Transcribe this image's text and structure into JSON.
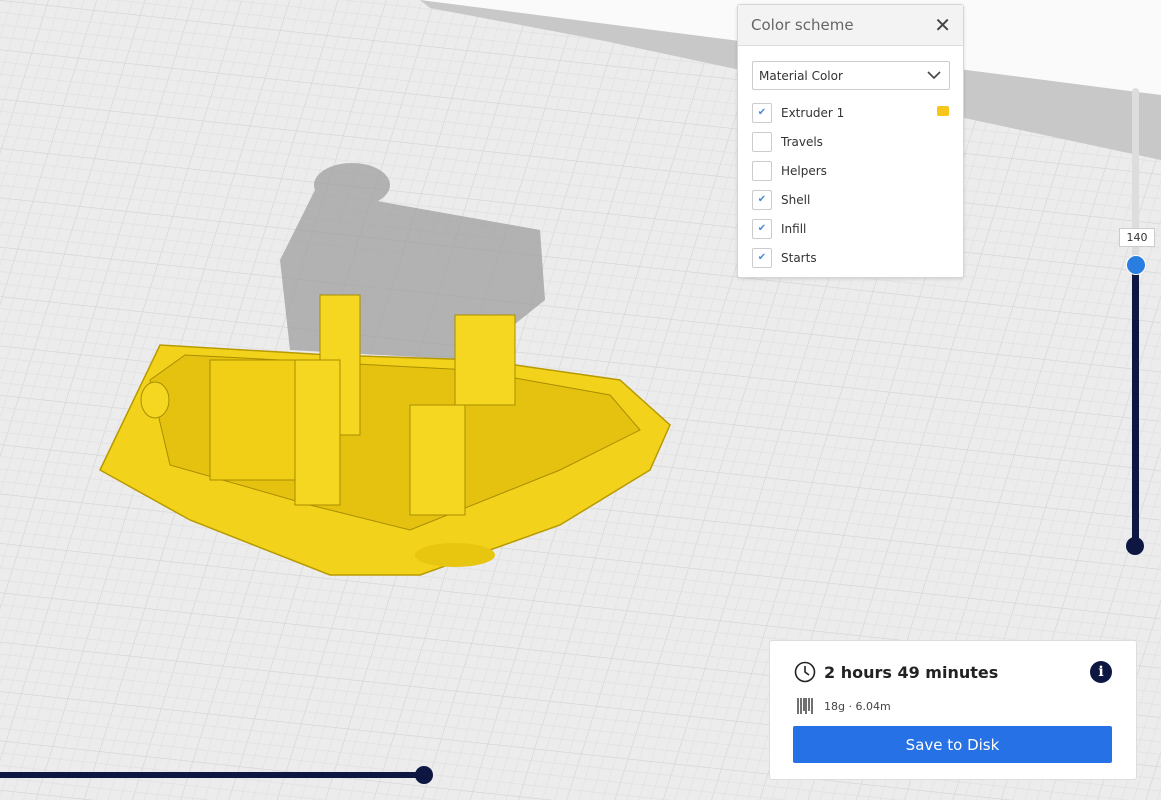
{
  "color_scheme": {
    "title": "Color scheme",
    "selected": "Material Color",
    "items": [
      {
        "label": "Extruder 1",
        "checked": true
      },
      {
        "label": "Travels",
        "checked": false
      },
      {
        "label": "Helpers",
        "checked": false
      },
      {
        "label": "Shell",
        "checked": true
      },
      {
        "label": "Infill",
        "checked": true
      },
      {
        "label": "Starts",
        "checked": true
      }
    ],
    "extruder_color": "#f6c71a"
  },
  "layer_slider": {
    "current_layer": "140"
  },
  "print_info": {
    "time": "2 hours 49 minutes",
    "material": "18g · 6.04m",
    "save_label": "Save to Disk"
  },
  "colors": {
    "accent": "#2671e5",
    "slider": "#0d1742",
    "model": "#f2d21b"
  }
}
